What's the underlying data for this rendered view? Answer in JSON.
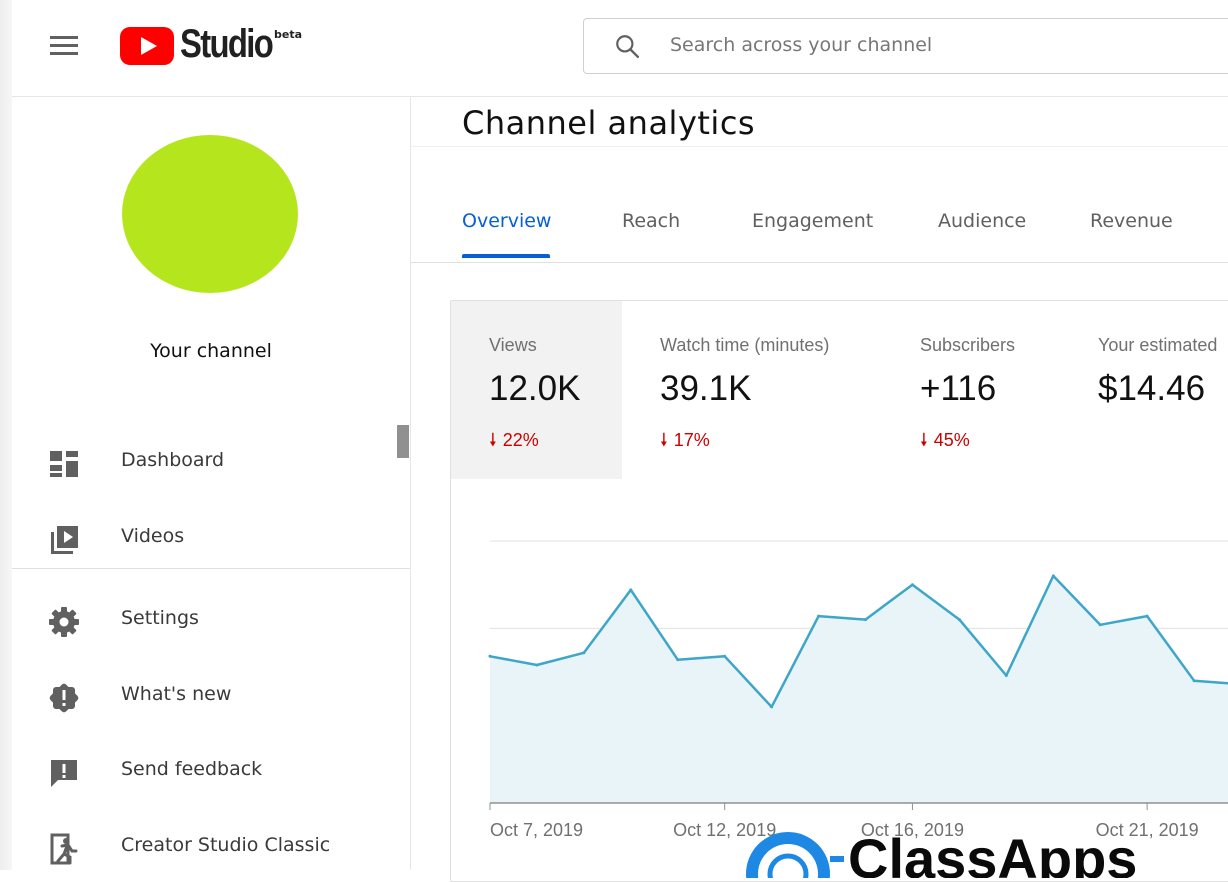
{
  "header": {
    "logo_text": "Studio",
    "logo_badge": "beta",
    "search_placeholder": "Search across your channel"
  },
  "sidebar": {
    "channel_label": "Your channel",
    "avatar_color": "#b5e61d",
    "items": [
      {
        "label": "Dashboard",
        "icon": "dashboard-icon"
      },
      {
        "label": "Videos",
        "icon": "videos-icon"
      },
      {
        "label": "Settings",
        "icon": "gear-icon"
      },
      {
        "label": "What's new",
        "icon": "alert-badge-icon"
      },
      {
        "label": "Send feedback",
        "icon": "feedback-icon"
      },
      {
        "label": "Creator Studio Classic",
        "icon": "exit-icon"
      }
    ]
  },
  "main": {
    "title": "Channel analytics",
    "tabs": [
      {
        "label": "Overview",
        "active": true
      },
      {
        "label": "Reach",
        "active": false
      },
      {
        "label": "Engagement",
        "active": false
      },
      {
        "label": "Audience",
        "active": false
      },
      {
        "label": "Revenue",
        "active": false
      }
    ],
    "metrics": [
      {
        "label": "Views",
        "value": "12.0K",
        "change": "22%",
        "direction": "down"
      },
      {
        "label": "Watch time (minutes)",
        "value": "39.1K",
        "change": "17%",
        "direction": "down"
      },
      {
        "label": "Subscribers",
        "value": "+116",
        "change": "45%",
        "direction": "down"
      },
      {
        "label": "Your estimated",
        "value": "$14.46"
      }
    ]
  },
  "chart_data": {
    "type": "area",
    "x_ticks": [
      "Oct 7, 2019",
      "Oct 12, 2019",
      "Oct 16, 2019",
      "Oct 21, 2019"
    ],
    "values": [
      84,
      79,
      86,
      122,
      82,
      84,
      55,
      107,
      105,
      125,
      105,
      73,
      130,
      102,
      107,
      70,
      68
    ],
    "ylim": [
      0,
      150
    ],
    "grid": true,
    "line_color": "#3ea6c8",
    "fill_color": "#e8f4f8"
  },
  "watermark": {
    "text": "ClassApps"
  },
  "colors": {
    "accent": "#065fd4",
    "negative": "#cc0000",
    "brand_red": "#ff0000"
  }
}
